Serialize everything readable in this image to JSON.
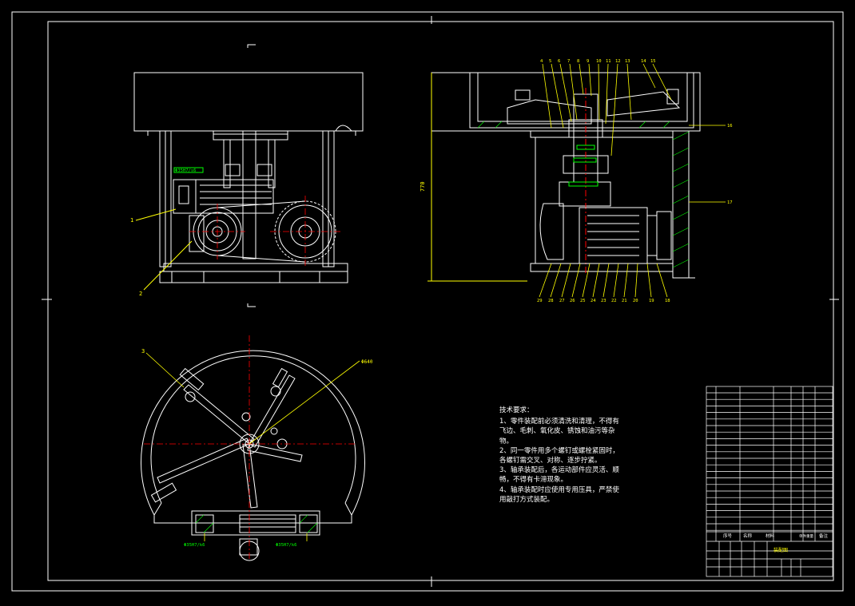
{
  "colors": {
    "background": "#000000",
    "outline": "#ffffff",
    "accent": "#ffff00",
    "centerline": "#ff0000",
    "hatch": "#00ff00",
    "dim": "#00ffff"
  },
  "front_view": {
    "part_labels": [
      "1",
      "2"
    ],
    "fit_label": "Φ35H7/s6"
  },
  "section_view": {
    "top_labels": [
      "4",
      "5",
      "6",
      "7",
      "8",
      "9",
      "10",
      "11",
      "12",
      "13",
      "14",
      "15"
    ],
    "bottom_labels": [
      "29",
      "28",
      "27",
      "26",
      "25",
      "24",
      "23",
      "22",
      "21",
      "20",
      "19",
      "18"
    ],
    "right_labels": [
      "16",
      "17"
    ],
    "height_dim": "770"
  },
  "plan_view": {
    "part_label": "3",
    "diameter_label": "Φ640",
    "fits": [
      "Φ35H7/k6",
      "Φ35H7/k6"
    ]
  },
  "technical_notes": {
    "title": "技术要求：",
    "items": [
      "1、零件装配前必须清洗和清理，不得有飞边、毛刺、氧化皮、锈蚀和油污等杂物。",
      "2、同一零件用多个螺钉或螺栓紧固时，各螺钉需交叉、对称、逐步拧紧。",
      "3、轴承装配后，各运动部件应灵活、顺畅，不得有卡滞现象。",
      "4、轴承装配时应使用专用压具，严禁使用敲打方式装配。"
    ]
  },
  "title_block": {
    "header": [
      "序号",
      "名称",
      "材料",
      "单件重量",
      "备注"
    ],
    "drawing_name": "装配图"
  }
}
